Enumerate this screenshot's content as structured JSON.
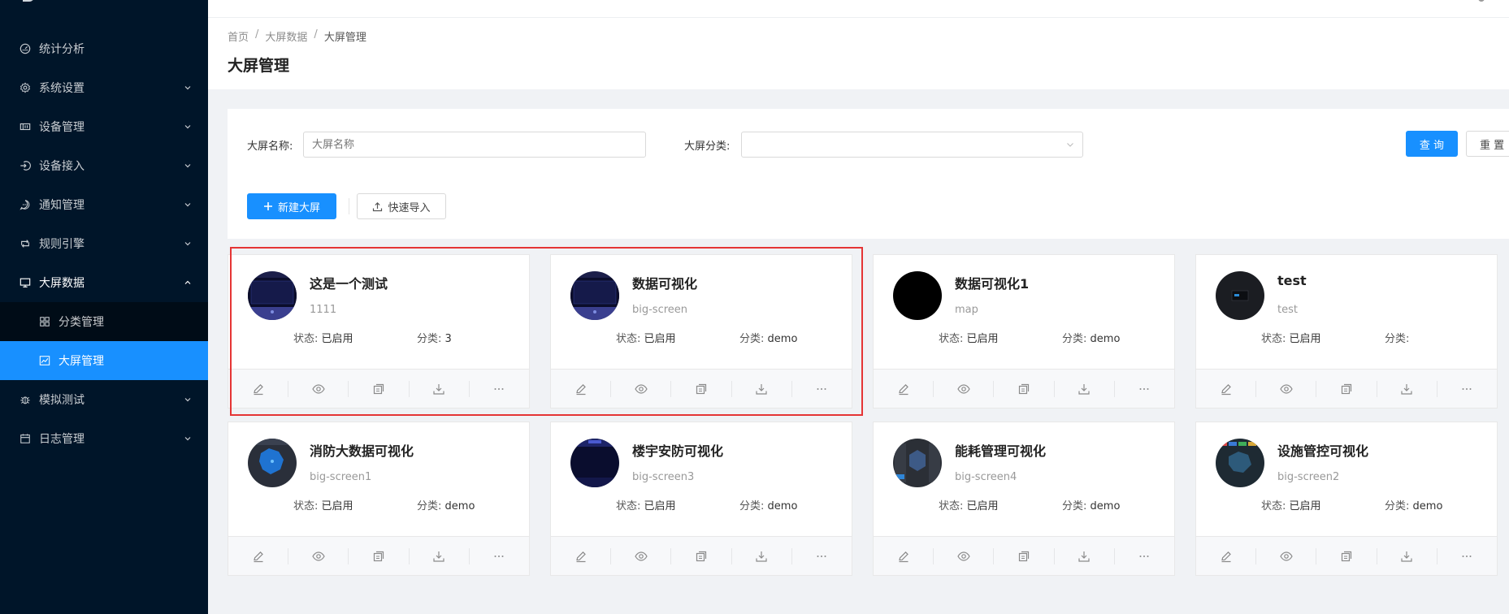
{
  "sidebar": {
    "items": [
      {
        "label": "统计分析",
        "icon": "dashboard-icon",
        "has_chevron": false
      },
      {
        "label": "系统设置",
        "icon": "gear-icon",
        "has_chevron": true
      },
      {
        "label": "设备管理",
        "icon": "device-icon",
        "has_chevron": true
      },
      {
        "label": "设备接入",
        "icon": "login-icon",
        "has_chevron": true
      },
      {
        "label": "通知管理",
        "icon": "message-icon",
        "has_chevron": true
      },
      {
        "label": "规则引擎",
        "icon": "retweet-icon",
        "has_chevron": true
      },
      {
        "label": "大屏数据",
        "icon": "desktop-icon",
        "has_chevron": true,
        "open": true
      },
      {
        "label": "模拟测试",
        "icon": "bug-icon",
        "has_chevron": true
      },
      {
        "label": "日志管理",
        "icon": "calendar-icon",
        "has_chevron": true
      }
    ],
    "submenu": [
      {
        "label": "分类管理",
        "icon": "appstore-icon",
        "active": false
      },
      {
        "label": "大屏管理",
        "icon": "line-chart-icon",
        "active": true
      }
    ]
  },
  "header": {
    "breadcrumb": [
      "首页",
      "大屏数据",
      "大屏管理"
    ],
    "separator": "/",
    "title": "大屏管理"
  },
  "search": {
    "name_label": "大屏名称:",
    "name_placeholder": "大屏名称",
    "category_label": "大屏分类:",
    "category_value": "",
    "query_button": "查 询",
    "reset_button": "重 置"
  },
  "toolbar": {
    "new_button": "新建大屏",
    "import_button": "快速导入"
  },
  "cards": [
    {
      "name": "这是一个测试",
      "desc": "1111",
      "status_label": "状态:",
      "status": "已启用",
      "category_label": "分类:",
      "category": "3",
      "thumb": "dark-dashboard"
    },
    {
      "name": "数据可视化",
      "desc": "big-screen",
      "status_label": "状态:",
      "status": "已启用",
      "category_label": "分类:",
      "category": "demo",
      "thumb": "dark-dashboard"
    },
    {
      "name": "数据可视化1",
      "desc": "map",
      "status_label": "状态:",
      "status": "已启用",
      "category_label": "分类:",
      "category": "demo",
      "thumb": "black"
    },
    {
      "name": "test",
      "desc": "test",
      "status_label": "状态:",
      "status": "已启用",
      "category_label": "分类:",
      "category": "",
      "thumb": "dark-small"
    },
    {
      "name": "消防大数据可视化",
      "desc": "big-screen1",
      "status_label": "状态:",
      "status": "已启用",
      "category_label": "分类:",
      "category": "demo",
      "thumb": "blue-map"
    },
    {
      "name": "楼宇安防可视化",
      "desc": "big-screen3",
      "status_label": "状态:",
      "status": "已启用",
      "category_label": "分类:",
      "category": "demo",
      "thumb": "navy"
    },
    {
      "name": "能耗管理可视化",
      "desc": "big-screen4",
      "status_label": "状态:",
      "status": "已启用",
      "category_label": "分类:",
      "category": "demo",
      "thumb": "gray-map"
    },
    {
      "name": "设施管控可视化",
      "desc": "big-screen2",
      "status_label": "状态:",
      "status": "已启用",
      "category_label": "分类:",
      "category": "demo",
      "thumb": "color-map"
    }
  ],
  "card_actions": [
    "edit-icon",
    "eye-icon",
    "copy-icon",
    "download-icon",
    "ellipsis-icon"
  ],
  "colors": {
    "sidebar_bg": "#001529",
    "primary": "#1890ff",
    "highlight": "#e53535"
  }
}
